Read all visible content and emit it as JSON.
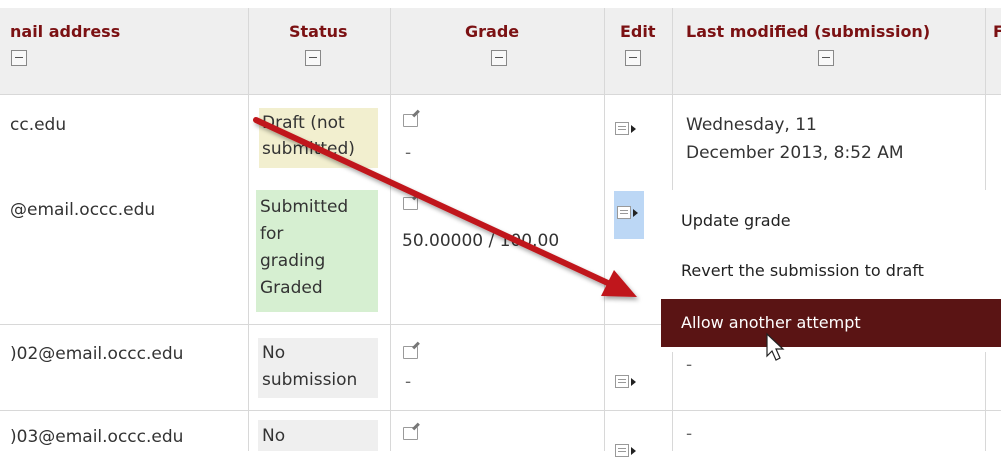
{
  "header": {
    "email_label": "nail address",
    "status_label": "Status",
    "grade_label": "Grade",
    "edit_label": "Edit",
    "lastmod_label": "Last modified (submission)",
    "next_label": "F"
  },
  "rows": [
    {
      "email": "cc.edu",
      "status_lines": [
        "Draft (not",
        "submitted)"
      ],
      "status_color": "#f2efcf",
      "grade": "-",
      "lastmod_lines": [
        "Wednesday, 11",
        "December 2013, 8:52 AM"
      ]
    },
    {
      "email": "@email.occc.edu",
      "status_lines": [
        "Submitted",
        "for",
        "grading",
        "Graded"
      ],
      "status_color": "#d6efd1",
      "grade": "50.00000 / 100.00"
    },
    {
      "email": ")02@email.occc.edu",
      "status_lines": [
        "No",
        "submission"
      ],
      "status_color": "#efefef",
      "grade": "-",
      "lastmod": "-"
    },
    {
      "email": ")03@email.occc.edu",
      "status_lines": [
        "No"
      ],
      "status_color": "#efefef",
      "grade": "",
      "lastmod": "-"
    }
  ],
  "menu": {
    "items": [
      "Update grade",
      "Revert the submission to draft",
      "Allow another attempt"
    ],
    "highlight_color": "#5a1414"
  },
  "colors": {
    "header_text": "#7b1113",
    "arrow": "#c0191d",
    "active_button": "#bcd7f5"
  }
}
